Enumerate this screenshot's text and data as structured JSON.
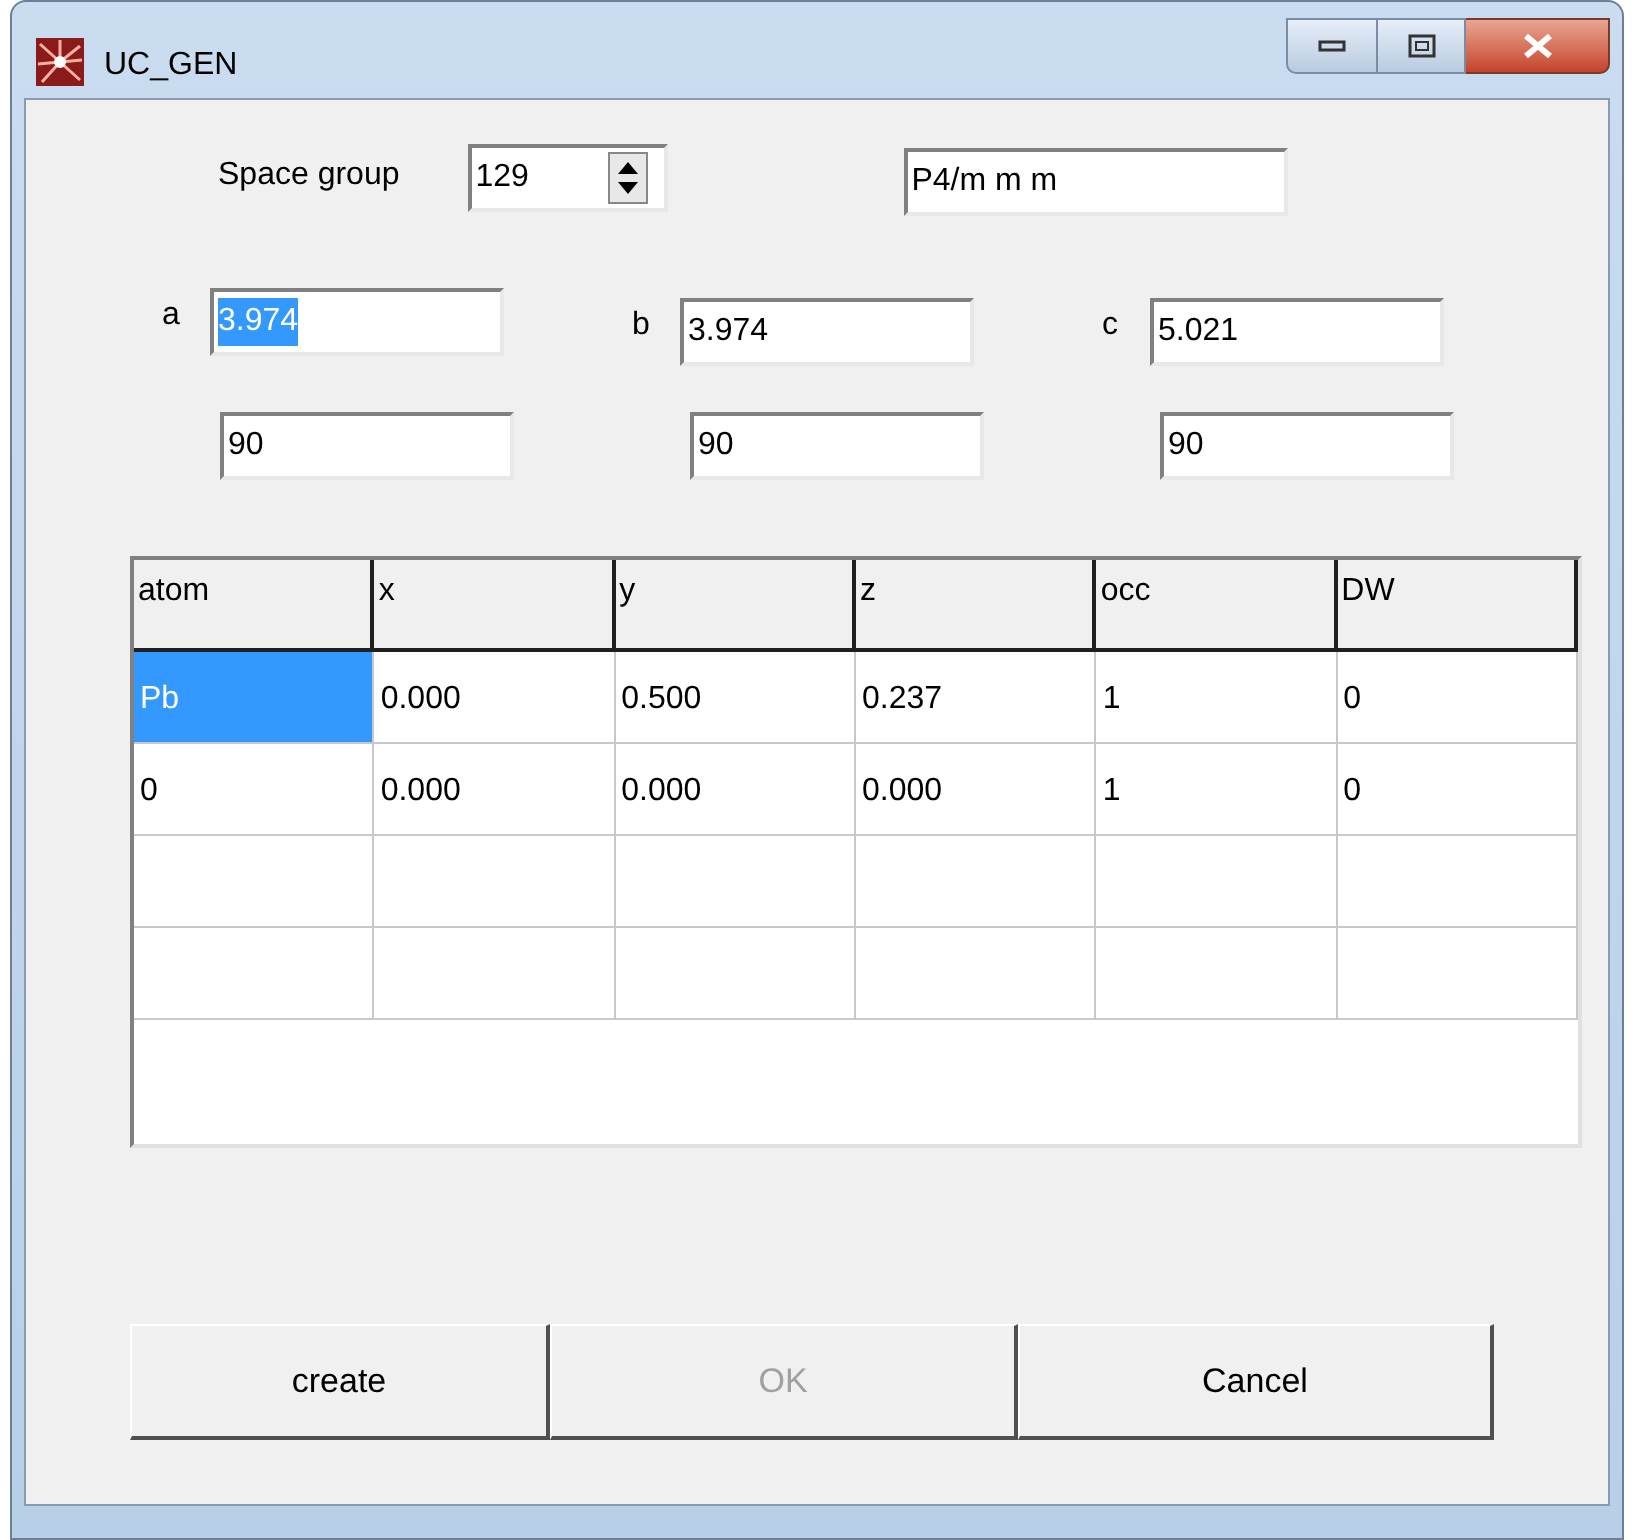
{
  "window": {
    "title": "UC_GEN"
  },
  "space_group": {
    "label": "Space group",
    "value": "129",
    "symbol": "P4/m m m"
  },
  "lengths": [
    {
      "label": "a",
      "value": "3.974",
      "selected": true
    },
    {
      "label": "b",
      "value": "3.974",
      "selected": false
    },
    {
      "label": "c",
      "value": "5.021",
      "selected": false
    }
  ],
  "angles": [
    "90",
    "90",
    "90"
  ],
  "table": {
    "columns": [
      "atom",
      "x",
      "y",
      "z",
      "occ",
      "DW"
    ],
    "rows": [
      {
        "cells": [
          {
            "text": "Pb",
            "selected": true
          },
          {
            "text": "0.000",
            "selected": false
          },
          {
            "text": "0.500",
            "selected": false
          },
          {
            "text": "0.237",
            "selected": false
          },
          {
            "text": "1",
            "selected": false
          },
          {
            "text": "0",
            "selected": false
          }
        ]
      },
      {
        "cells": [
          {
            "text": "0",
            "selected": false
          },
          {
            "text": "0.000",
            "selected": false
          },
          {
            "text": "0.000",
            "selected": false
          },
          {
            "text": "0.000",
            "selected": false
          },
          {
            "text": "1",
            "selected": false
          },
          {
            "text": "0",
            "selected": false
          }
        ]
      }
    ]
  },
  "buttons": [
    {
      "label": "create",
      "disabled": false
    },
    {
      "label": "OK",
      "disabled": true
    },
    {
      "label": "Cancel",
      "disabled": false
    }
  ]
}
